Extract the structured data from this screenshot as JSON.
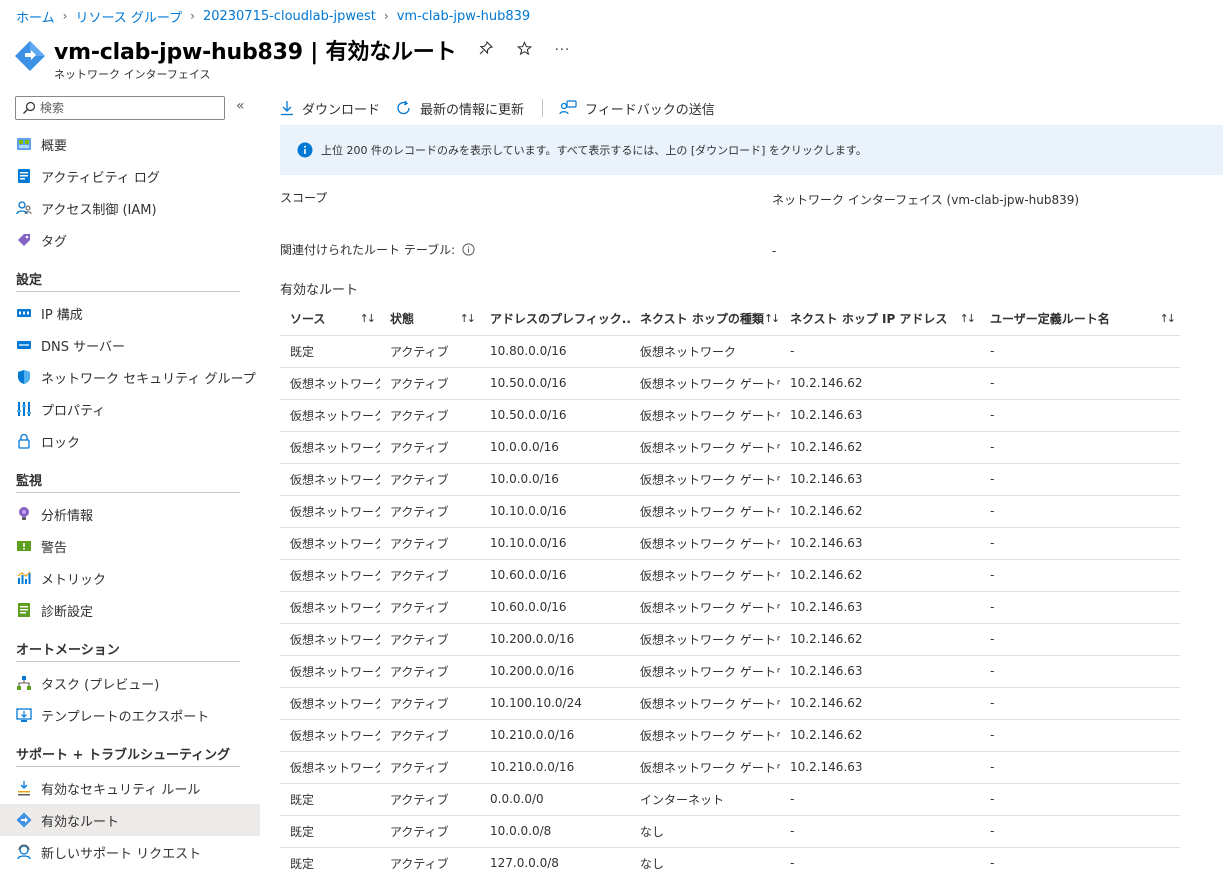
{
  "breadcrumb": [
    "ホーム",
    "リソース グループ",
    "20230715-cloudlab-jpwest",
    "vm-clab-jpw-hub839"
  ],
  "title": "vm-clab-jpw-hub839 | 有効なルート",
  "subtitle": "ネットワーク インターフェイス",
  "title_actions": {
    "pin": "pin-icon",
    "star": "star-icon",
    "more": "···"
  },
  "search": {
    "placeholder": "検索",
    "collapse": "«"
  },
  "sidebar": {
    "items": [
      {
        "label": "概要",
        "icon": "overview-icon"
      },
      {
        "label": "アクティビティ ログ",
        "icon": "activity-log-icon"
      },
      {
        "label": "アクセス制御 (IAM)",
        "icon": "iam-icon"
      },
      {
        "label": "タグ",
        "icon": "tag-icon"
      }
    ],
    "sections": [
      {
        "title": "設定",
        "items": [
          {
            "label": "IP 構成",
            "icon": "ip-config-icon"
          },
          {
            "label": "DNS サーバー",
            "icon": "dns-icon"
          },
          {
            "label": "ネットワーク セキュリティ グループ",
            "icon": "nsg-icon"
          },
          {
            "label": "プロパティ",
            "icon": "properties-icon"
          },
          {
            "label": "ロック",
            "icon": "lock-icon"
          }
        ]
      },
      {
        "title": "監視",
        "items": [
          {
            "label": "分析情報",
            "icon": "insights-icon"
          },
          {
            "label": "警告",
            "icon": "alerts-icon"
          },
          {
            "label": "メトリック",
            "icon": "metrics-icon"
          },
          {
            "label": "診断設定",
            "icon": "diagnostics-icon"
          }
        ]
      },
      {
        "title": "オートメーション",
        "items": [
          {
            "label": "タスク (プレビュー)",
            "icon": "tasks-icon"
          },
          {
            "label": "テンプレートのエクスポート",
            "icon": "export-template-icon"
          }
        ]
      },
      {
        "title": "サポート + トラブルシューティング",
        "items": [
          {
            "label": "有効なセキュリティ ルール",
            "icon": "security-rules-icon"
          },
          {
            "label": "有効なルート",
            "icon": "routes-icon",
            "selected": true
          },
          {
            "label": "新しいサポート リクエスト",
            "icon": "support-icon"
          }
        ]
      }
    ]
  },
  "toolbar": {
    "download": "ダウンロード",
    "refresh": "最新の情報に更新",
    "feedback": "フィードバックの送信"
  },
  "info": "上位 200 件のレコードのみを表示しています。すべて表示するには、上の [ダウンロード] をクリックします。",
  "scope": {
    "label": "スコープ",
    "value": "ネットワーク インターフェイス (vm-clab-jpw-hub839)"
  },
  "route_table": {
    "label": "関連付けられたルート テーブル:",
    "value": "-"
  },
  "routes_title": "有効なルート",
  "table": {
    "columns": [
      "ソース",
      "状態",
      "アドレスのプレフィック...",
      "ネクスト ホップの種類",
      "ネクスト ホップ IP アドレス",
      "ユーザー定義ルート名"
    ],
    "rows": [
      [
        "既定",
        "アクティブ",
        "10.80.0.0/16",
        "仮想ネットワーク",
        "-",
        "-"
      ],
      [
        "仮想ネットワーク...",
        "アクティブ",
        "10.50.0.0/16",
        "仮想ネットワーク ゲートウェイ",
        "10.2.146.62",
        "-"
      ],
      [
        "仮想ネットワーク...",
        "アクティブ",
        "10.50.0.0/16",
        "仮想ネットワーク ゲートウェイ",
        "10.2.146.63",
        "-"
      ],
      [
        "仮想ネットワーク...",
        "アクティブ",
        "10.0.0.0/16",
        "仮想ネットワーク ゲートウェイ",
        "10.2.146.62",
        "-"
      ],
      [
        "仮想ネットワーク...",
        "アクティブ",
        "10.0.0.0/16",
        "仮想ネットワーク ゲートウェイ",
        "10.2.146.63",
        "-"
      ],
      [
        "仮想ネットワーク...",
        "アクティブ",
        "10.10.0.0/16",
        "仮想ネットワーク ゲートウェイ",
        "10.2.146.62",
        "-"
      ],
      [
        "仮想ネットワーク...",
        "アクティブ",
        "10.10.0.0/16",
        "仮想ネットワーク ゲートウェイ",
        "10.2.146.63",
        "-"
      ],
      [
        "仮想ネットワーク...",
        "アクティブ",
        "10.60.0.0/16",
        "仮想ネットワーク ゲートウェイ",
        "10.2.146.62",
        "-"
      ],
      [
        "仮想ネットワーク...",
        "アクティブ",
        "10.60.0.0/16",
        "仮想ネットワーク ゲートウェイ",
        "10.2.146.63",
        "-"
      ],
      [
        "仮想ネットワーク...",
        "アクティブ",
        "10.200.0.0/16",
        "仮想ネットワーク ゲートウェイ",
        "10.2.146.62",
        "-"
      ],
      [
        "仮想ネットワーク...",
        "アクティブ",
        "10.200.0.0/16",
        "仮想ネットワーク ゲートウェイ",
        "10.2.146.63",
        "-"
      ],
      [
        "仮想ネットワーク...",
        "アクティブ",
        "10.100.10.0/24",
        "仮想ネットワーク ゲートウェイ",
        "10.2.146.62",
        "-"
      ],
      [
        "仮想ネットワーク...",
        "アクティブ",
        "10.210.0.0/16",
        "仮想ネットワーク ゲートウェイ",
        "10.2.146.62",
        "-"
      ],
      [
        "仮想ネットワーク...",
        "アクティブ",
        "10.210.0.0/16",
        "仮想ネットワーク ゲートウェイ",
        "10.2.146.63",
        "-"
      ],
      [
        "既定",
        "アクティブ",
        "0.0.0.0/0",
        "インターネット",
        "-",
        "-"
      ],
      [
        "既定",
        "アクティブ",
        "10.0.0.0/8",
        "なし",
        "-",
        "-"
      ],
      [
        "既定",
        "アクティブ",
        "127.0.0.0/8",
        "なし",
        "-",
        "-"
      ]
    ]
  },
  "colors": {
    "accent": "#0078d4",
    "info_bg": "#eaf2fb",
    "selected_bg": "#edebe9"
  }
}
